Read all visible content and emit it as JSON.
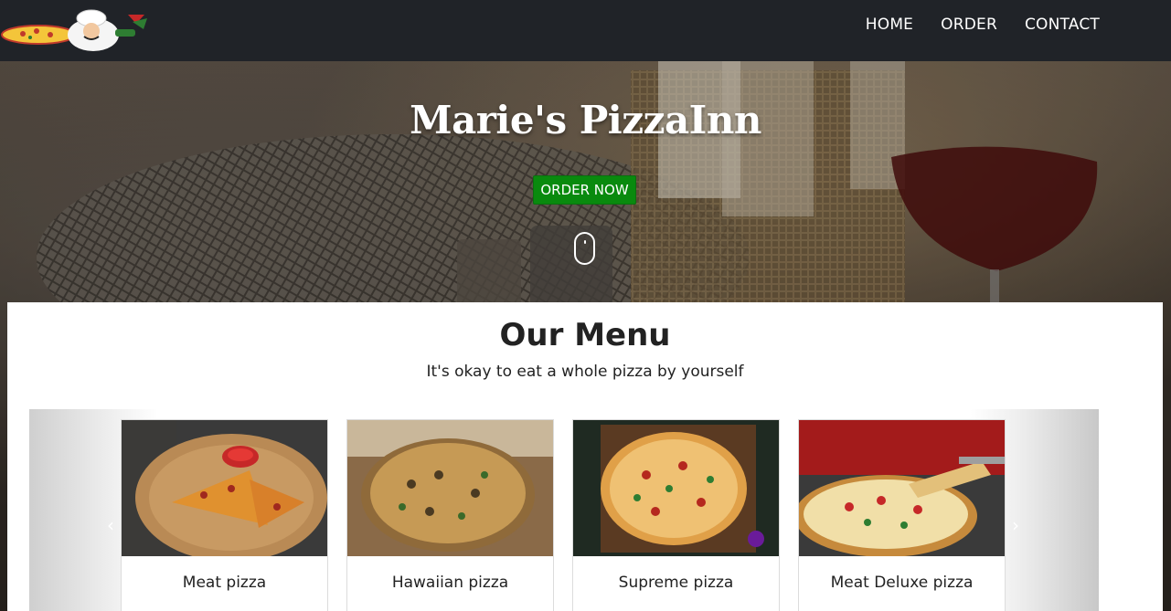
{
  "nav": {
    "logo_icon": "pizza-chef-logo-icon",
    "links": [
      "HOME",
      "ORDER",
      "CONTACT"
    ]
  },
  "hero": {
    "title": "Marie's PizzaInn",
    "order_button": "ORDER NOW",
    "scroll_icon": "scroll-mouse-icon"
  },
  "menu": {
    "title": "Our Menu",
    "subtitle": "It's okay to eat a whole pizza by yourself",
    "prev_icon": "chevron-left-icon",
    "next_icon": "chevron-right-icon",
    "prev_glyph": "‹",
    "next_glyph": "›",
    "items": [
      {
        "name": "Meat pizza"
      },
      {
        "name": "Hawaiian pizza"
      },
      {
        "name": "Supreme pizza"
      },
      {
        "name": "Meat Deluxe pizza"
      }
    ]
  },
  "colors": {
    "navbar": "#202328",
    "order_button": "#098a0e",
    "text": "#222222"
  }
}
